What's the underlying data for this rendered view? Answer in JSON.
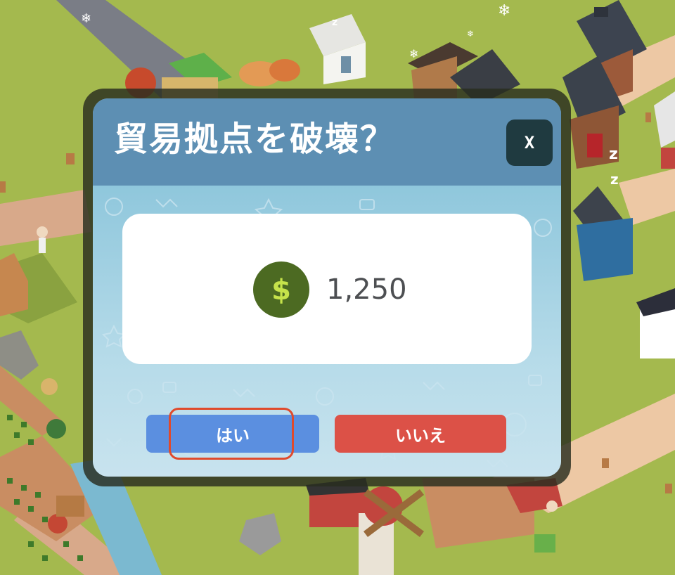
{
  "dialog": {
    "title": "貿易拠点を破壊？",
    "close_label": "X",
    "price": "1,250",
    "price_icon": "dollar-coin-icon",
    "yes_label": "はい",
    "no_label": "いいえ"
  },
  "colors": {
    "header": "#5d8fb3",
    "body": "#a9d3e5",
    "close_button": "#1f3a40",
    "yes_button": "#5b8fe0",
    "no_button": "#dc5147",
    "coin": "#4c6a22",
    "coin_symbol": "#c6e34b",
    "highlight": "#e04a2c"
  }
}
